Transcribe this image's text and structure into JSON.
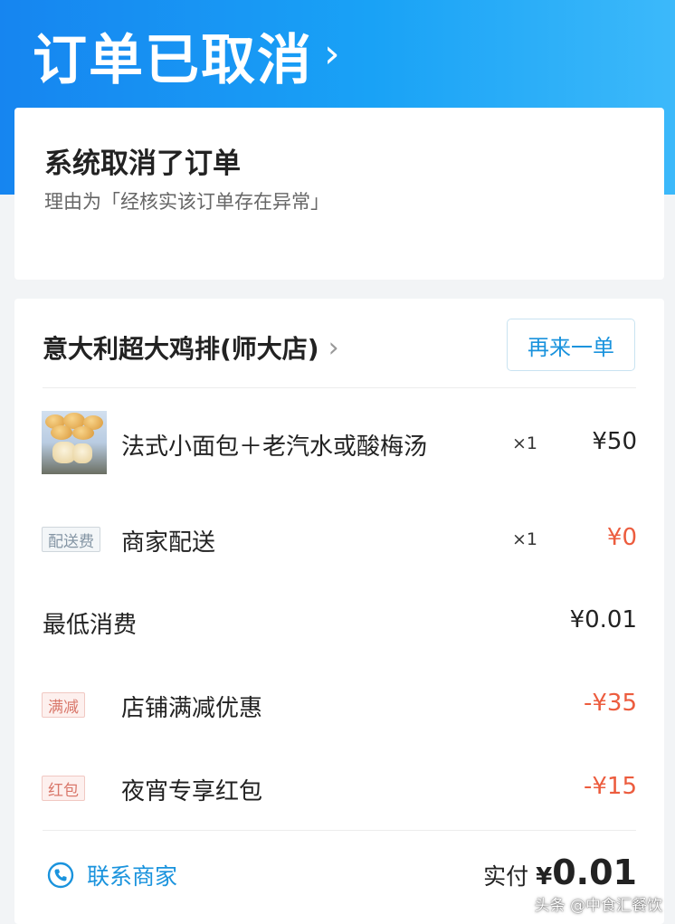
{
  "header": {
    "status_title": "订单已取消",
    "chevron": "›",
    "gradient_colors": [
      "#1685f0",
      "#3cb9fa"
    ]
  },
  "cancel_card": {
    "title": "系统取消了订单",
    "reason": "理由为「经核实该订单存在异常」"
  },
  "order": {
    "shop_name": "意大利超大鸡排(师大店)",
    "shop_chevron": "›",
    "reorder_button": "再来一单",
    "items": [
      {
        "name": "法式小面包＋老汽水或酸梅汤",
        "qty": "×1",
        "price": "¥50",
        "image": "bread-thumbnail"
      }
    ],
    "delivery": {
      "tag": "配送费",
      "name": "商家配送",
      "qty": "×1",
      "price": "¥0"
    },
    "min_spend": {
      "name": "最低消费",
      "price": "¥0.01"
    },
    "discounts": [
      {
        "tag": "满减",
        "name": "店铺满减优惠",
        "price": "-¥35"
      },
      {
        "tag": "红包",
        "name": "夜宵专享红包",
        "price": "-¥15"
      }
    ],
    "contact_merchant": "联系商家",
    "contact_icon": "phone-icon",
    "paid_label": "实付",
    "paid_symbol": "¥",
    "paid_amount": "0.01"
  },
  "watermark": "头条 @中食汇餐饮",
  "colors": {
    "accent_blue": "#1a93dd",
    "discount_red": "#ec5c3e",
    "background": "#f2f4f6"
  }
}
